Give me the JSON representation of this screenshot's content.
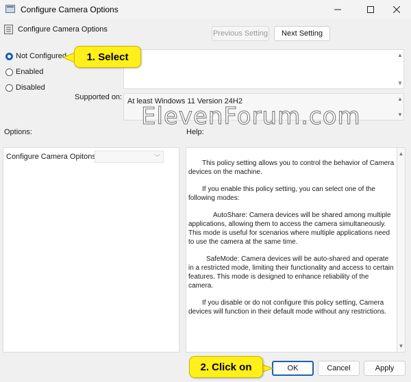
{
  "window": {
    "title": "Configure Camera Options",
    "minimize_icon": "minimize-icon",
    "maximize_icon": "maximize-icon",
    "close_icon": "close-icon"
  },
  "header": {
    "policy_title": "Configure Camera Options",
    "previous_label": "Previous Setting",
    "next_label": "Next Setting"
  },
  "state": {
    "options": [
      "Not Configured",
      "Enabled",
      "Disabled"
    ],
    "selected": "Not Configured",
    "not_configured": "Not Configured",
    "enabled": "Enabled",
    "disabled": "Disabled"
  },
  "supported": {
    "label": "Supported on:",
    "value": "At least Windows 11 Version 24H2"
  },
  "options_section": {
    "label": "Options:",
    "field_label": "Configure Camera Opitons:"
  },
  "help_section": {
    "label": "Help:",
    "paragraphs": [
      "This policy setting allows you to control the behavior of Camera devices on the machine.",
      "If you enable this policy setting, you can select one of the following modes:",
      "AutoShare: Camera devices will be shared among multiple applications, allowing them to access the camera simultaneously. This mode is useful for scenarios where multiple applications need to use the camera at the same time.",
      "SafeMode: Camera devices will be auto-shared and operate in a restricted mode, limiting their functionality and access to certain features. This mode is designed to enhance reliability of the camera.",
      "If you disable or do not configure this policy setting, Camera devices will function in their default mode without any restrictions."
    ]
  },
  "footer": {
    "ok_label": "OK",
    "cancel_label": "Cancel",
    "apply_label": "Apply"
  },
  "annotations": {
    "callout_1": "1. Select",
    "callout_2": "2. Click on",
    "watermark": "ElevenForum.com"
  },
  "colors": {
    "callout": "#ffef1a",
    "radio_selected": "#1b5fb0"
  }
}
